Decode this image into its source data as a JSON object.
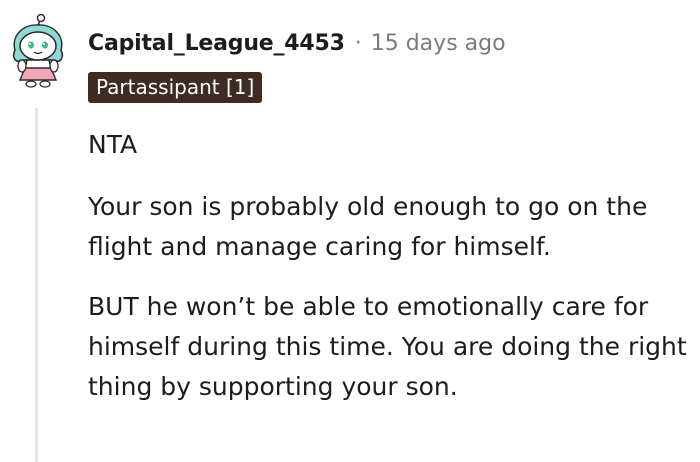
{
  "comment": {
    "username": "Capital_League_4453",
    "separator": "·",
    "timestamp": "15 days ago",
    "flair": "Partassipant [1]",
    "paragraphs": [
      "NTA",
      "Your son is probably old enough to go on the flight and manage caring for himself.",
      "BUT he won’t be able to emotionally care for himself during this time. You are doing the right thing by supporting your son."
    ],
    "avatar_icon": "snoo-avatar-icon",
    "colors": {
      "flair_bg": "#3f2b23",
      "text": "#1c1c1c",
      "meta": "#7c7c7c",
      "thread_line": "#e4e6e8"
    }
  }
}
